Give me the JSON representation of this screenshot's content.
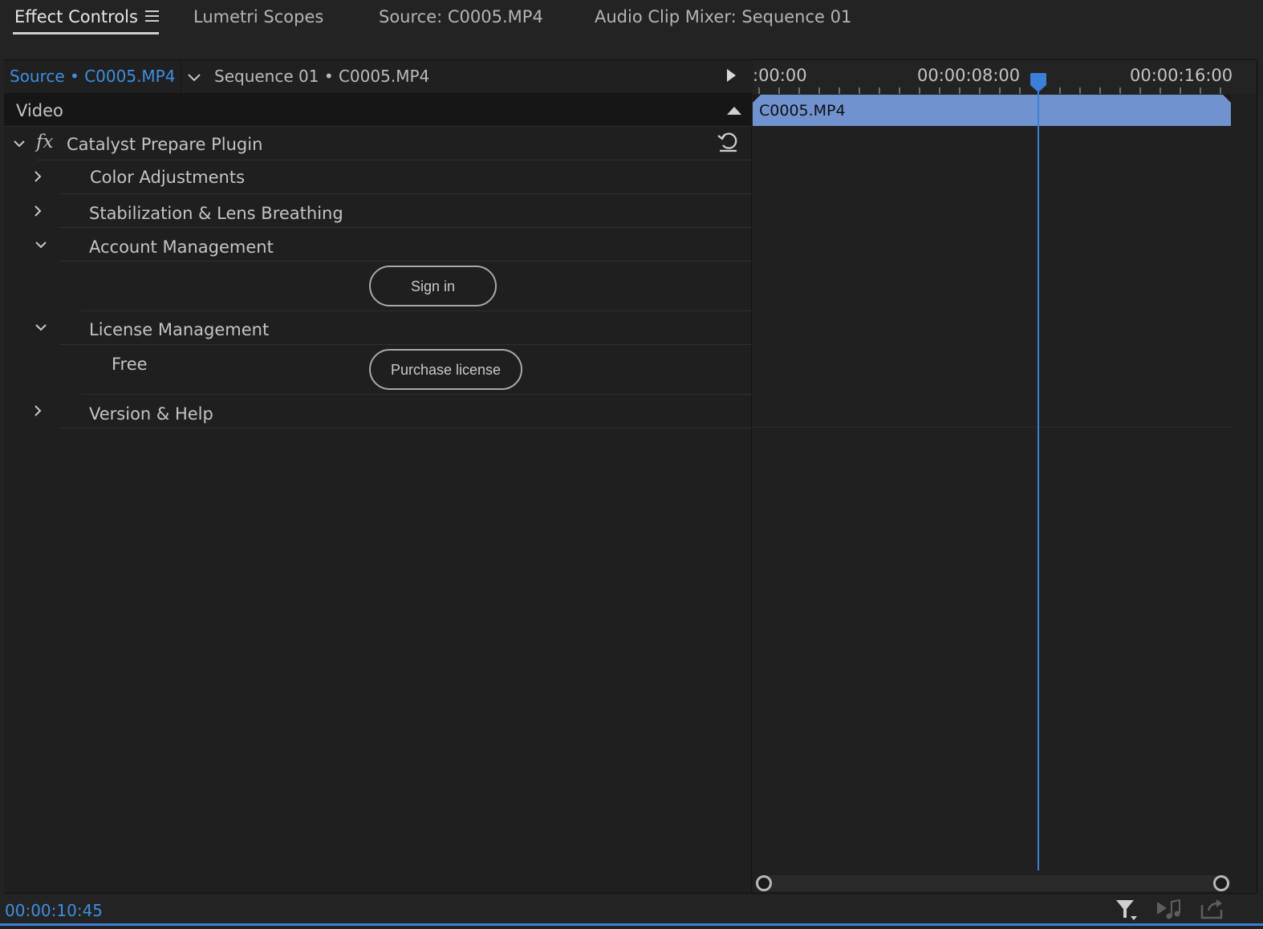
{
  "tabs": [
    {
      "label": "Effect Controls",
      "active": true
    },
    {
      "label": "Lumetri Scopes",
      "active": false
    },
    {
      "label": "Source: C0005.MP4",
      "active": false
    },
    {
      "label": "Audio Clip Mixer: Sequence 01",
      "active": false
    }
  ],
  "header": {
    "source_label": "Source • C0005.MP4",
    "sequence_label": "Sequence 01 • C0005.MP4"
  },
  "video_section": {
    "label": "Video"
  },
  "effect": {
    "name": "Catalyst Prepare Plugin",
    "fx_glyph": "fx",
    "groups": [
      {
        "label": "Color Adjustments",
        "expanded": false
      },
      {
        "label": "Stabilization & Lens Breathing",
        "expanded": false
      },
      {
        "label": "Account Management",
        "expanded": true
      },
      {
        "label": "License Management",
        "expanded": true
      },
      {
        "label": "Version & Help",
        "expanded": false
      }
    ],
    "sign_in_label": "Sign in",
    "license_status": "Free",
    "purchase_label": "Purchase license"
  },
  "timeline": {
    "ruler_labels": [
      ":00:00",
      "00:00:08:00",
      "00:00:16:00"
    ],
    "clip_name": "C0005.MP4",
    "current_time": "00:00:10:45"
  },
  "colors": {
    "accent": "#3d8fe0",
    "clip": "#7093cf",
    "background": "#1f1f1f"
  },
  "icons": {
    "menu": "hamburger-icon",
    "reset": "reset-icon",
    "filter": "filter-icon",
    "audio": "audio-play-icon",
    "export": "export-icon"
  }
}
